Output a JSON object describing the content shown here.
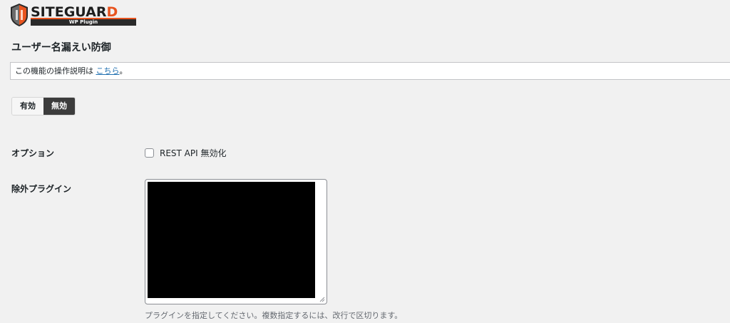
{
  "brand": {
    "name_main": "SITEGUAR",
    "name_last": "D",
    "tagline": "WP Plugin",
    "colors": {
      "accent": "#e8541f",
      "dark": "#2a2a2a"
    }
  },
  "page": {
    "title": "ユーザー名漏えい防御"
  },
  "notice": {
    "text": "この機能の操作説明は ",
    "link_text": "こちら",
    "suffix": "。"
  },
  "toggle": {
    "on_label": "有効",
    "off_label": "無効",
    "selected": "無効"
  },
  "options": {
    "label": "オプション",
    "rest_api_label": "REST API 無効化",
    "rest_api_checked": false
  },
  "exclude_plugins": {
    "label": "除外プラグイン",
    "hint": "プラグインを指定してください。複数指定するには、改行で区切ります。"
  }
}
